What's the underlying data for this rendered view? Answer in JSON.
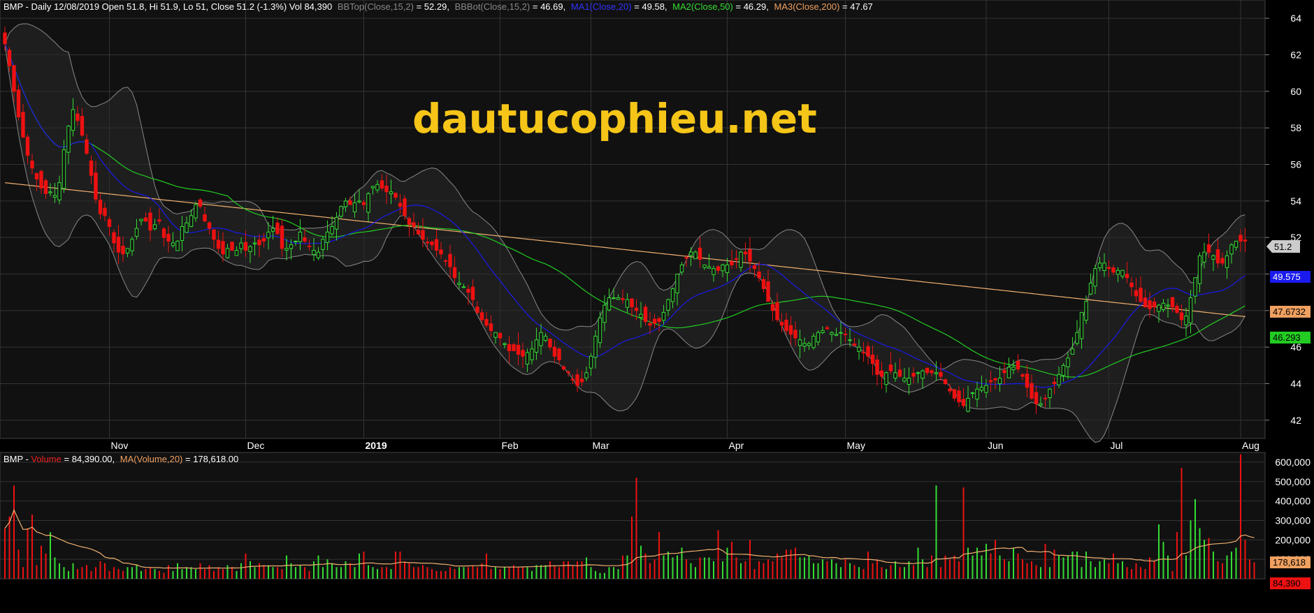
{
  "header": {
    "price_prefix": "BMP - Daily 12/08/2019 Open 51.8, Hi 51.9, Lo 51, Close 51.2 (-1.3%) Vol 84,390",
    "bbtop_label": "BBTop(Close,15,2)",
    "bbtop_value": " = 52.29,",
    "bbbot_label": "BBBot(Close,15,2)",
    "bbbot_value": " = 46.69,",
    "ma1_label": "MA1(Close,20)",
    "ma1_value": " = 49.58,",
    "ma2_label": "MA2(Close,50)",
    "ma2_value": " = 46.29,",
    "ma3_label": "MA3(Close,200)",
    "ma3_value": " = 47.67"
  },
  "volume_header": {
    "prefix": "BMP - ",
    "vol_label": "Volume",
    "vol_value": " = 84,390.00,",
    "ma_label": "MA(Volume,20)",
    "ma_value": " = 178,618.00"
  },
  "watermark": "dautucophieu.net",
  "price_tags": {
    "close": "51.2",
    "ma1": "49.575",
    "ma3": "47.6732",
    "ma2": "46.293"
  },
  "volume_tags": {
    "ma": "178,618",
    "vol": "84,390"
  },
  "colors": {
    "up": "#33dd33",
    "down": "#ee1111",
    "ma1": "#1a1aee",
    "ma2": "#22cc22",
    "ma3": "#f0b070",
    "bb": "#888888",
    "grid": "#333333",
    "background": "#111111"
  },
  "chart_data": [
    {
      "type": "candlestick",
      "title": "BMP - Daily",
      "ylim": [
        41,
        65
      ],
      "yticks": [
        42,
        44,
        46,
        48,
        50,
        52,
        54,
        56,
        58,
        60,
        62,
        64
      ],
      "x_labels": [
        "Nov",
        "Dec",
        "2019",
        "Feb",
        "Mar",
        "Apr",
        "May",
        "Jun",
        "Jul",
        "Aug"
      ],
      "x_label_bars": [
        23,
        53,
        79,
        109,
        129,
        159,
        185,
        216,
        243,
        272
      ],
      "bar_count": 282,
      "close": [
        62.6,
        61.4,
        60.0,
        58.6,
        57.5,
        56.5,
        55.8,
        55.2,
        54.7,
        54.4,
        54.5,
        54.3,
        55.0,
        56.8,
        58.1,
        59.0,
        58.4,
        57.6,
        56.6,
        55.4,
        54.1,
        53.3,
        53.2,
        52.6,
        51.7,
        51.2,
        51.1,
        51.4,
        51.9,
        52.5,
        53.0,
        52.9,
        52.4,
        52.7,
        52.9,
        52.0,
        51.8,
        51.7,
        51.8,
        52.6,
        52.8,
        53.2,
        53.8,
        53.7,
        52.9,
        52.5,
        51.9,
        51.4,
        51.1,
        51.4,
        51.3,
        51.3,
        51.7,
        51.3,
        51.5,
        51.7,
        51.6,
        51.8,
        52.3,
        52.5,
        52.2,
        51.4,
        51.4,
        51.6,
        51.8,
        52.3,
        51.8,
        51.5,
        51.3,
        51.2,
        51.9,
        52.3,
        52.6,
        53.1,
        53.7,
        54.0,
        53.8,
        53.9,
        54.0,
        53.8,
        54.4,
        54.8,
        54.9,
        54.7,
        54.5,
        54.5,
        54.2,
        53.7,
        53.2,
        52.7,
        52.6,
        52.2,
        51.9,
        51.7,
        51.6,
        51.3,
        51.1,
        50.7,
        50.4,
        49.8,
        49.5,
        49.3,
        49.0,
        48.6,
        47.9,
        47.5,
        47.2,
        46.9,
        46.8,
        46.5,
        46.2,
        45.8,
        45.8,
        45.6,
        45.5,
        45.7,
        45.9,
        46.4,
        46.8,
        46.6,
        46.0,
        45.5,
        45.3,
        44.8,
        44.6,
        44.2,
        43.9,
        44.1,
        44.6,
        45.5,
        46.6,
        47.6,
        48.3,
        48.7,
        48.7,
        48.7,
        48.6,
        48.6,
        48.2,
        48.0,
        47.8,
        47.4,
        47.2,
        47.3,
        47.4,
        47.9,
        48.6,
        49.2,
        50.0,
        50.5,
        50.9,
        51.2,
        51.2,
        50.8,
        50.5,
        50.4,
        50.3,
        50.2,
        50.5,
        50.5,
        50.5,
        50.8,
        51.2,
        51.1,
        50.7,
        50.3,
        49.8,
        49.2,
        48.5,
        48.0,
        47.5,
        47.2,
        46.9,
        46.7,
        46.5,
        46.4,
        46.2,
        46.2,
        46.6,
        46.8,
        46.9,
        47.0,
        46.8,
        46.7,
        46.8,
        46.7,
        46.4,
        46.1,
        46.0,
        45.7,
        45.5,
        45.1,
        44.5,
        44.4,
        44.6,
        44.7,
        44.6,
        44.4,
        44.3,
        44.3,
        44.4,
        44.6,
        44.7,
        44.6,
        44.6,
        44.6,
        44.4,
        44.0,
        43.6,
        43.2,
        43.0,
        42.8,
        43.2,
        43.5,
        43.7,
        43.8,
        43.9,
        44.1,
        44.2,
        44.3,
        44.6,
        44.9,
        44.9,
        44.8,
        44.4,
        43.8,
        43.2,
        42.9,
        42.9,
        43.2,
        43.7,
        44.0,
        44.5,
        45.0,
        45.4,
        45.9,
        46.8,
        47.9,
        48.5,
        49.5,
        50.3,
        50.6,
        50.6,
        50.3,
        50.1,
        50.2,
        50.2,
        49.8,
        49.3,
        48.8,
        48.5,
        48.2,
        48.1,
        48.2,
        48.3,
        48.4,
        48.3,
        48.2,
        47.9,
        47.5,
        47.7,
        48.7,
        49.8,
        51.0,
        51.2,
        51.2,
        51.0,
        50.6,
        50.6,
        51.0,
        51.6,
        51.8,
        51.8,
        51.8
      ],
      "series": [
        {
          "name": "BBTop(Close,15,2)",
          "last": 52.29
        },
        {
          "name": "BBBot(Close,15,2)",
          "last": 46.69
        },
        {
          "name": "MA1(Close,20)",
          "last": 49.58
        },
        {
          "name": "MA2(Close,50)",
          "last": 46.29
        },
        {
          "name": "MA3(Close,200)",
          "last": 47.67
        }
      ]
    },
    {
      "type": "bar",
      "title": "Volume",
      "ylim": [
        0,
        650000
      ],
      "yticks": [
        100000,
        200000,
        300000,
        400000,
        500000,
        600000
      ],
      "ytick_labels": [
        "100,000",
        "200,000",
        "300,000",
        "400,000",
        "500,000",
        "600,000"
      ],
      "values": [
        260000,
        320000,
        480000,
        150000,
        60000,
        260000,
        330000,
        70000,
        170000,
        130000,
        240000,
        110000,
        80000,
        60000,
        40000,
        80000,
        50000,
        60000,
        70000,
        40000,
        60000,
        90000,
        80000,
        40000,
        60000,
        50000,
        40000,
        60000,
        60000,
        70000,
        40000,
        50000,
        60000,
        50000,
        40000,
        30000,
        70000,
        40000,
        80000,
        50000,
        60000,
        60000,
        50000,
        80000,
        50000,
        70000,
        40000,
        60000,
        50000,
        70000,
        60000,
        40000,
        80000,
        130000,
        90000,
        60000,
        80000,
        70000,
        70000,
        60000,
        60000,
        50000,
        120000,
        80000,
        60000,
        70000,
        60000,
        40000,
        90000,
        120000,
        60000,
        100000,
        80000,
        60000,
        60000,
        90000,
        80000,
        60000,
        130000,
        140000,
        70000,
        60000,
        50000,
        60000,
        60000,
        50000,
        140000,
        140000,
        90000,
        80000,
        60000,
        60000,
        70000,
        60000,
        50000,
        40000,
        40000,
        40000,
        60000,
        50000,
        60000,
        60000,
        60000,
        70000,
        60000,
        80000,
        130000,
        50000,
        60000,
        50000,
        60000,
        60000,
        70000,
        60000,
        60000,
        60000,
        40000,
        70000,
        70000,
        70000,
        90000,
        70000,
        60000,
        90000,
        90000,
        70000,
        90000,
        90000,
        110000,
        60000,
        40000,
        30000,
        30000,
        60000,
        60000,
        50000,
        120000,
        120000,
        320000,
        520000,
        170000,
        130000,
        80000,
        100000,
        240000,
        120000,
        140000,
        110000,
        120000,
        160000,
        100000,
        80000,
        60000,
        110000,
        110000,
        110000,
        90000,
        250000,
        90000,
        160000,
        190000,
        110000,
        80000,
        90000,
        200000,
        50000,
        90000,
        80000,
        100000,
        90000,
        130000,
        110000,
        150000,
        150000,
        160000,
        110000,
        110000,
        120000,
        80000,
        80000,
        100000,
        90000,
        100000,
        80000,
        60000,
        100000,
        80000,
        70000,
        60000,
        50000,
        140000,
        80000,
        100000,
        60000,
        50000,
        70000,
        90000,
        60000,
        60000,
        90000,
        70000,
        160000,
        100000,
        60000,
        120000,
        480000,
        60000,
        120000,
        100000,
        120000,
        90000,
        470000,
        160000,
        120000,
        160000,
        120000,
        180000,
        130000,
        200000,
        120000,
        100000,
        90000,
        160000,
        130000,
        100000,
        80000,
        90000,
        70000,
        60000,
        180000,
        60000,
        150000,
        120000,
        110000,
        120000,
        140000,
        140000,
        60000,
        140000,
        90000,
        60000,
        90000,
        100000,
        80000,
        130000,
        80000,
        90000,
        60000,
        50000,
        80000,
        60000,
        50000,
        110000,
        90000,
        280000,
        190000,
        120000,
        40000,
        240000,
        570000,
        120000,
        300000,
        410000,
        260000,
        200000,
        210000,
        140000,
        90000,
        80000,
        120000,
        140000,
        160000,
        640000,
        200000,
        100000,
        84390
      ],
      "series": [
        {
          "name": "Volume",
          "last": 84390
        },
        {
          "name": "MA(Volume,20)",
          "last": 178618
        }
      ]
    }
  ]
}
